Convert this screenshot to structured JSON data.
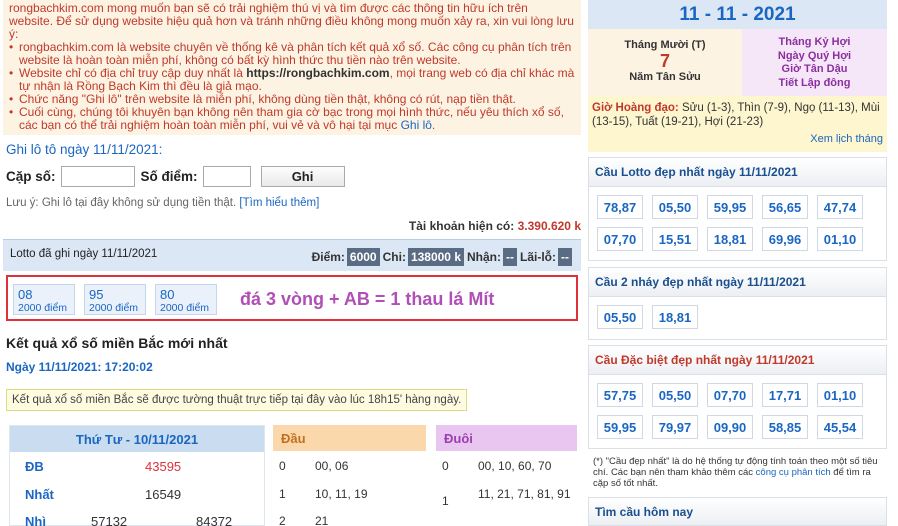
{
  "notice": {
    "line1": "rongbachkim.com mong muốn bạn sẽ có trải nghiệm thú vị và tìm được các thông tin hữu ích trên website. Để sử dụng website hiệu quả hơn và tránh những điều không mong muốn xảy ra, xin vui lòng lưu ý:",
    "item1": "rongbachkim.com là website chuyên về thống kê và phân tích kết quả xổ số. Các công cụ phân tích trên website là hoàn toàn miễn phí, không có bất kỳ hình thức thu tiền nào trên website.",
    "item2_pre": "Website chỉ có địa chỉ truy cập duy nhất là ",
    "item2_url": "https://rongbachkim.com",
    "item2_post": ", mọi trang web có địa chỉ khác mà tự nhận là Rồng Bạch Kim thì đều là giả mạo.",
    "item3": "Chức năng \"Ghi lô\" trên website là miễn phí, không dùng tiền thật, không có rút, nạp tiền thật.",
    "item4_pre": "Cuối cùng, chúng tôi khuyên bạn không nên tham gia cờ bạc trong mọi hình thức, nếu yêu thích xổ số, các bạn có thể trải nghiệm hoàn toàn miễn phí, vui vẻ và vô hại tại mục ",
    "item4_link": "Ghi lô",
    "item4_post": "."
  },
  "ghilo": {
    "title": "Ghi lô tô ngày 11/11/2021:",
    "cap_so_label": "Cặp số:",
    "so_diem_label": "Số điểm:",
    "button": "Ghi",
    "luu_y": "Lưu ý: Ghi lô tại đây không sử dụng tiền thật. ",
    "luu_y_link": "[Tìm hiểu thêm]",
    "account_label": "Tài khoản hiện có: ",
    "account_value": "3.390.620 k"
  },
  "lotto": {
    "title": "Lotto đã ghi ngày 11/11/2021",
    "diem_label": "Điểm:",
    "diem_value": "6000",
    "chi_label": "Chi:",
    "chi_value": "138000 k",
    "nhan_label": "Nhận:",
    "nhan_value": "--",
    "lailo_label": "Lãi-lỗ:",
    "lailo_value": "--",
    "entries": [
      {
        "num": "08",
        "pts": "2000 điểm"
      },
      {
        "num": "95",
        "pts": "2000 điểm"
      },
      {
        "num": "80",
        "pts": "2000 điểm"
      }
    ],
    "annotation": "đá 3 vòng + AB = 1 thau lá Mít"
  },
  "ketqua": {
    "title": "Kết quả xổ số miền Bắc mới nhất",
    "date": "Ngày 11/11/2021: 17:20:02",
    "note": "Kết quả xổ số miền Bắc sẽ được tường thuật trực tiếp tại đây vào lúc 18h15' hàng ngày.",
    "table_head": "Thứ Tư - 10/11/2021",
    "db_label": "ĐB",
    "db_value": "43595",
    "nhat_label": "Nhất",
    "nhat_value": "16549",
    "nhi_label": "Nhì",
    "nhi_values": [
      "57132",
      "84372"
    ],
    "dau_head": "Đầu",
    "dau": [
      {
        "k": "0",
        "v": "00, 06"
      },
      {
        "k": "1",
        "v": "10, 11, 19"
      },
      {
        "k": "2",
        "v": "21"
      }
    ],
    "duoi_head": "Đuôi",
    "duoi": [
      {
        "k": "0",
        "v": "00, 10, 60, 70"
      },
      {
        "k": "1",
        "v": "11, 21, 71, 81, 91"
      }
    ]
  },
  "calendar": {
    "date": "11 - 11 - 2021",
    "lunar_month": "Tháng Mười (T)",
    "lunar_day": "7",
    "lunar_year": "Năm Tân Sửu",
    "thang": "Tháng Kỷ Hợi",
    "ngay": "Ngày Quý Hợi",
    "gio": "Giờ Tân Dậu",
    "tiet": "Tiết Lập đông",
    "hoangdao_label": "Giờ Hoàng đạo:",
    "hoangdao_text": " Sửu (1-3), Thìn (7-9), Ngọ (11-13), Mùi (13-15), Tuất (19-21), Hợi (21-23)",
    "view_calendar": "Xem lịch tháng"
  },
  "cau_lotto": {
    "title": "Cầu Lotto đẹp nhất ngày 11/11/2021",
    "row1": [
      "78,87",
      "05,50",
      "59,95",
      "56,65",
      "47,74"
    ],
    "row2": [
      "07,70",
      "15,51",
      "18,81",
      "69,96",
      "01,10"
    ]
  },
  "cau_2nhay": {
    "title": "Cầu 2 nháy đẹp nhất ngày 11/11/2021",
    "nums": [
      "05,50",
      "18,81"
    ]
  },
  "cau_db": {
    "title": "Cầu Đặc biệt đẹp nhất ngày 11/11/2021",
    "row1": [
      "57,75",
      "05,50",
      "07,70",
      "17,71",
      "01,10"
    ],
    "row2": [
      "59,95",
      "79,97",
      "09,90",
      "58,85",
      "45,54"
    ]
  },
  "foot_note": {
    "pre": "(*) \"Cầu đẹp nhất\" là do hệ thống tự động tính toán theo một số tiêu chí. Các bạn nên tham khảo thêm các ",
    "link": "công cụ phân tích",
    "post": " để tìm ra cặp số tốt nhất."
  },
  "tim_cau": "Tìm cầu hôm nay"
}
